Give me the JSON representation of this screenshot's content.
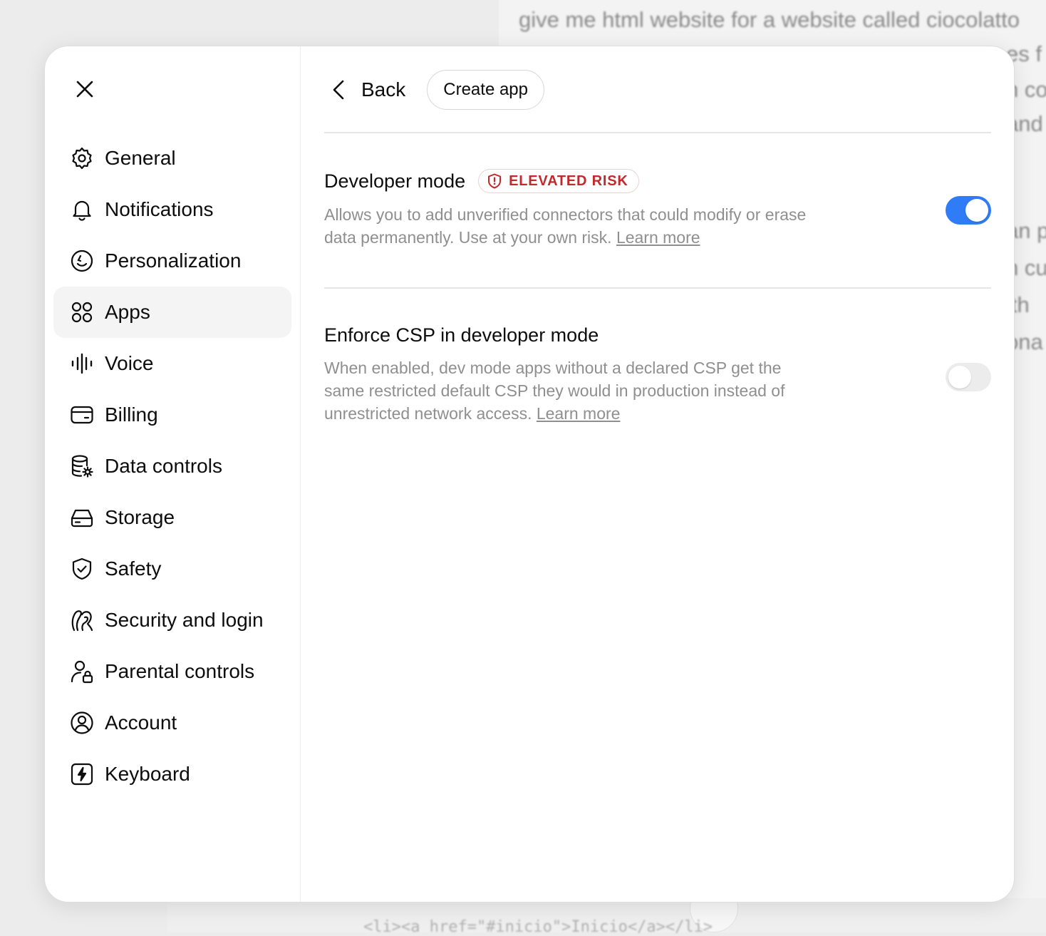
{
  "background": {
    "lines": [
      "give me html website for a website called ciocolatto",
      "es f",
      "n co",
      "and",
      "an p",
      "n cu",
      "ith",
      "ona"
    ],
    "code": "<li><a href=\"#inicio\">Inicio</a></li>"
  },
  "sidebar": {
    "items": [
      {
        "label": "General",
        "icon": "gear-icon"
      },
      {
        "label": "Notifications",
        "icon": "bell-icon"
      },
      {
        "label": "Personalization",
        "icon": "personalization-icon"
      },
      {
        "label": "Apps",
        "icon": "apps-grid-icon",
        "active": true
      },
      {
        "label": "Voice",
        "icon": "voice-wave-icon"
      },
      {
        "label": "Billing",
        "icon": "credit-card-icon"
      },
      {
        "label": "Data controls",
        "icon": "database-gear-icon"
      },
      {
        "label": "Storage",
        "icon": "storage-drive-icon"
      },
      {
        "label": "Safety",
        "icon": "shield-check-icon"
      },
      {
        "label": "Security and login",
        "icon": "security-login-icon"
      },
      {
        "label": "Parental controls",
        "icon": "person-lock-icon"
      },
      {
        "label": "Account",
        "icon": "account-circle-icon"
      },
      {
        "label": "Keyboard",
        "icon": "keyboard-bolt-icon"
      }
    ]
  },
  "topbar": {
    "back_label": "Back",
    "create_label": "Create app"
  },
  "settings": {
    "developer_mode": {
      "title": "Developer mode",
      "badge": "ELEVATED RISK",
      "desc": "Allows you to add unverified connectors that could modify or erase data permanently. Use at your own risk. ",
      "learn_more": "Learn more",
      "enabled": true
    },
    "enforce_csp": {
      "title": "Enforce CSP in developer mode",
      "desc": "When enabled, dev mode apps without a declared CSP get the same restricted default CSP they would in production instead of unrestricted network access. ",
      "learn_more": "Learn more",
      "enabled": false
    }
  },
  "colors": {
    "accent": "#2f7cf6",
    "risk": "#c02a2a"
  }
}
